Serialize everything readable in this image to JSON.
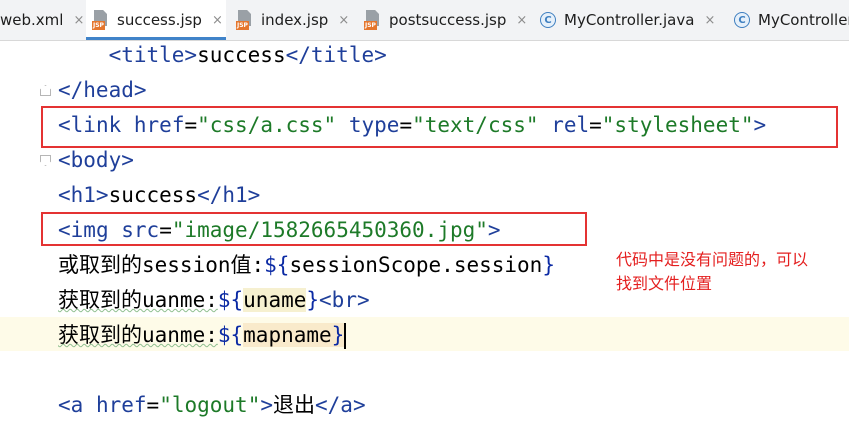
{
  "tabs": [
    {
      "label": "web.xml",
      "type": "xml",
      "active": false
    },
    {
      "label": "success.jsp",
      "type": "jsp",
      "active": true
    },
    {
      "label": "index.jsp",
      "type": "jsp",
      "active": false
    },
    {
      "label": "postsuccess.jsp",
      "type": "jsp",
      "active": false
    },
    {
      "label": "MyController.java",
      "type": "class",
      "active": false
    },
    {
      "label": "MyController",
      "type": "class",
      "active": false
    }
  ],
  "tab_close_glyph": "×",
  "class_icon_letter": "C",
  "jsp_icon_text": "JSP",
  "code": {
    "l0": {
      "indent": "    ",
      "open": "<title>",
      "text": "success",
      "close": "</title>"
    },
    "l1": {
      "tag": "</head>"
    },
    "l2": {
      "lt": "<",
      "name": "link",
      "a1": "href",
      "v1": "\"css/a.css\"",
      "a2": "type",
      "v2": "\"text/css\"",
      "a3": "rel",
      "v3": "\"stylesheet\"",
      "gt": ">"
    },
    "l3": {
      "tag": "<body>"
    },
    "l4": {
      "open": "<h1>",
      "text": "success",
      "close": "</h1>"
    },
    "l5": {
      "lt": "<",
      "name": "img",
      "a1": "src",
      "v1": "\"image/1582665450360.jpg\"",
      "gt": ">"
    },
    "l6": {
      "text": "或取到的session值:",
      "el_open": "${",
      "expr": "sessionScope.session",
      "el_close": "}"
    },
    "l7": {
      "text": "获取到的uanme:",
      "el_open": "${",
      "expr": "uname",
      "el_close": "}",
      "tag": "<br>"
    },
    "l8": {
      "text": "获取到的uanme:",
      "el_open": "${",
      "expr": "mapname",
      "el_close": "}"
    },
    "l10": {
      "open_lt": "<",
      "name": "a",
      "a1": "href",
      "v1": "\"logout\"",
      "gt": ">",
      "text": "退出",
      "close": "</a>"
    }
  },
  "annotation": {
    "note": "代码中是没有问题的，可以\n找到文件位置",
    "color": "#e43333"
  }
}
